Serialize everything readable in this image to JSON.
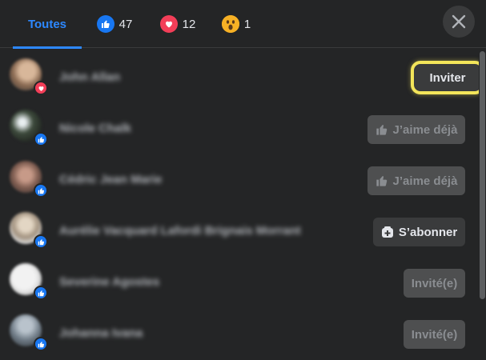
{
  "tabs": {
    "all_label": "Toutes",
    "like_count": "47",
    "love_count": "12",
    "wow_count": "1"
  },
  "colors": {
    "accent": "#2d88ff",
    "like": "#1877f2",
    "love": "#f33e58",
    "wow": "#f7b125",
    "highlight": "#f3e55a"
  },
  "people": [
    {
      "name": "John Allan",
      "reaction": "love",
      "action": "Inviter",
      "action_state": "invite"
    },
    {
      "name": "Nicole Chalk",
      "reaction": "like",
      "action": "J’aime déjà",
      "action_state": "liked"
    },
    {
      "name": "Cédric Jean Marie",
      "reaction": "like",
      "action": "J’aime déjà",
      "action_state": "liked"
    },
    {
      "name": "Aurélie Vacquard Lafordi Brignais Morrant",
      "reaction": "like",
      "action": "S’abonner",
      "action_state": "follow"
    },
    {
      "name": "Severine Agostes",
      "reaction": "like",
      "action": "Invité(e)",
      "action_state": "invited"
    },
    {
      "name": "Johanna Ivana",
      "reaction": "like",
      "action": "Invité(e)",
      "action_state": "invited"
    }
  ]
}
